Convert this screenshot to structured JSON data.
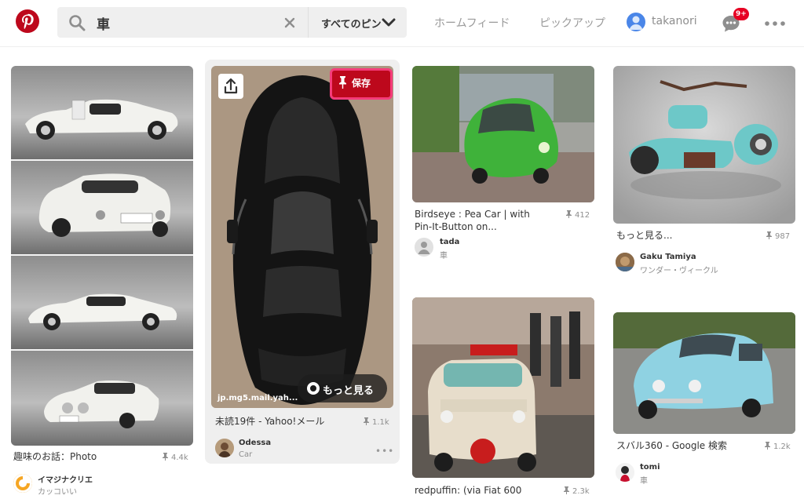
{
  "search": {
    "query": "車",
    "scope_label": "すべてのピン"
  },
  "nav": {
    "home": "ホームフィード",
    "pickup": "ピックアップ",
    "username": "takanori",
    "notification_badge": "9+"
  },
  "colors": {
    "brand": "#bd081c",
    "save_button_outline": "#f53c7a",
    "muted_text": "#8e8e8e",
    "card_hover": "#efefef"
  },
  "icons": [
    "pinterest-logo",
    "search-icon",
    "clear-icon",
    "chevron-down-icon",
    "message-icon",
    "more-icon",
    "pin-icon",
    "share-icon",
    "circle-icon"
  ],
  "hover_pin": {
    "save_label": "保存",
    "more_label": "もっと見る",
    "source_domain": "jp.mg5.mail.yah..."
  },
  "pins": [
    {
      "title": "趣味のお話：Photo",
      "save_count": "4.4k",
      "author": "イマジナクリエ",
      "board": "カッコいい"
    },
    {
      "title": "未読19件 - Yahoo!メール",
      "save_count": "1.1k",
      "author": "Odessa",
      "board": "Car"
    },
    {
      "title": "Birdseye : Pea Car | with Pin-It-Button on...",
      "save_count": "412",
      "author": "tada",
      "board": "車"
    },
    {
      "title": "redpuffin: (via Fiat 600",
      "save_count": "2.3k"
    },
    {
      "title": "もっと見る...",
      "save_count": "987",
      "author": "Gaku Tamiya",
      "board": "ワンダー・ヴィークル"
    },
    {
      "title": "スバル360 - Google 検索",
      "save_count": "1.2k",
      "author": "tomi",
      "board": "車"
    }
  ]
}
